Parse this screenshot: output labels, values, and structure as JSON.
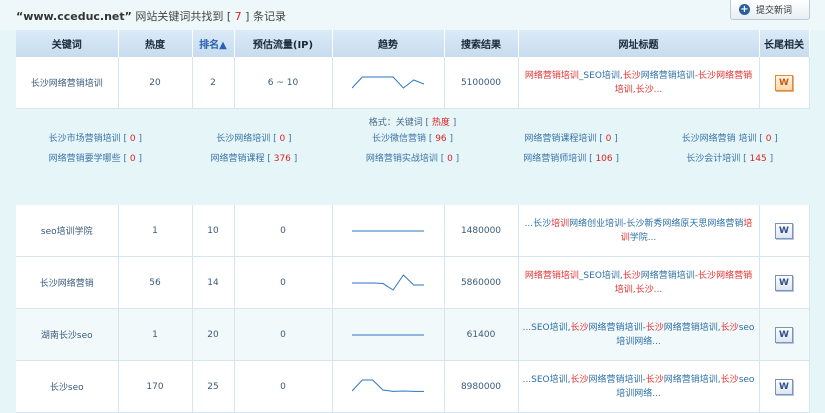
{
  "header": {
    "site": "“www.cceduc.net”",
    "text_before": " 网站关键词共找到 [ ",
    "count": "7",
    "text_after": " ] 条记录"
  },
  "submit_button": {
    "label": "提交新词",
    "icon": "plus-circle-icon"
  },
  "table": {
    "columns": [
      "关键词",
      "热度",
      "排名▲",
      "预估流量(IP)",
      "趋势",
      "搜索结果",
      "网址标题",
      "长尾相关"
    ],
    "rows": [
      {
        "keyword": "长沙网络营销培训",
        "heat": "20",
        "rank": "2",
        "traffic": "6 ~ 10",
        "trend": [
          0.75,
          0.2,
          0.2,
          0.2,
          0.2,
          0.75,
          0.35,
          0.55
        ],
        "results": "5100000",
        "title_parts": [
          [
            "网络营销培训",
            "red"
          ],
          [
            "_SEO培训,",
            "blue"
          ],
          [
            "长沙",
            "red"
          ],
          [
            "网络营销培训",
            "blue"
          ],
          [
            "-长沙",
            "red"
          ],
          [
            "网络营销培训,长沙...",
            "red"
          ]
        ],
        "longtail_icon": "word-doc-orange-icon"
      },
      {
        "keyword": "seo培训学院",
        "heat": "1",
        "rank": "10",
        "traffic": "0",
        "trend": [
          0.5,
          0.5,
          0.5,
          0.5,
          0.5,
          0.5,
          0.5,
          0.5
        ],
        "results": "1480000",
        "title_parts": [
          [
            "...长沙",
            "blue"
          ],
          [
            "培训",
            "red"
          ],
          [
            "网络创业培训-长沙新秀网络原天思网络营销",
            "blue"
          ],
          [
            "培训",
            "red"
          ],
          [
            "学院...",
            "blue"
          ]
        ],
        "longtail_icon": "word-doc-icon"
      },
      {
        "keyword": "长沙网络营销",
        "heat": "56",
        "rank": "14",
        "traffic": "0",
        "trend": [
          0.5,
          0.5,
          0.5,
          0.52,
          0.85,
          0.1,
          0.6,
          0.6
        ],
        "results": "5860000",
        "title_parts": [
          [
            "网络营销培训",
            "red"
          ],
          [
            "_SEO培训,",
            "blue"
          ],
          [
            "长沙",
            "red"
          ],
          [
            "网络营销培训",
            "blue"
          ],
          [
            "-长沙",
            "red"
          ],
          [
            "网络营销培训,长沙...",
            "red"
          ]
        ],
        "longtail_icon": "word-doc-icon"
      },
      {
        "keyword": "湖南长沙seo",
        "heat": "1",
        "rank": "20",
        "traffic": "0",
        "trend": [
          0.5,
          0.5,
          0.5,
          0.5,
          0.5,
          0.5,
          0.5,
          0.5
        ],
        "results": "61400",
        "title_parts": [
          [
            "...SEO培训,",
            "blue"
          ],
          [
            "长沙",
            "red"
          ],
          [
            "网络营销培训-",
            "blue"
          ],
          [
            "长沙",
            "red"
          ],
          [
            "网络营销培训,",
            "blue"
          ],
          [
            "长沙",
            "red"
          ],
          [
            "seo培训网络...",
            "blue"
          ]
        ],
        "longtail_icon": "word-doc-icon"
      },
      {
        "keyword": "长沙seo",
        "heat": "170",
        "rank": "25",
        "traffic": "0",
        "trend": [
          0.7,
          0.15,
          0.15,
          0.65,
          0.72,
          0.7,
          0.72,
          0.72
        ],
        "results": "8980000",
        "title_parts": [
          [
            "...SEO培训,",
            "blue"
          ],
          [
            "长沙",
            "red"
          ],
          [
            "网络营销培训-",
            "blue"
          ],
          [
            "长沙",
            "red"
          ],
          [
            "网络营销培训,",
            "blue"
          ],
          [
            "长沙",
            "red"
          ],
          [
            "seo培训网络...",
            "blue"
          ]
        ],
        "longtail_icon": "word-doc-icon"
      }
    ]
  },
  "related": {
    "hint_before": "格式：关键词 [ ",
    "hint_hot": "热度",
    "hint_after": " ]",
    "items": [
      {
        "name": "长沙市场营销培训",
        "n": "0"
      },
      {
        "name": "长沙网络培训",
        "n": "0"
      },
      {
        "name": "长沙微信营销",
        "n": "96"
      },
      {
        "name": "网络营销课程培训",
        "n": "0"
      },
      {
        "name": "长沙网络营销 培训",
        "n": "0"
      },
      {
        "name": "网络营销要学哪些",
        "n": "0"
      },
      {
        "name": "网络营销课程",
        "n": "376"
      },
      {
        "name": "网络营销实战培训",
        "n": "0"
      },
      {
        "name": "网络营销师培训",
        "n": "106"
      },
      {
        "name": "长沙会计培训",
        "n": "145"
      }
    ]
  }
}
